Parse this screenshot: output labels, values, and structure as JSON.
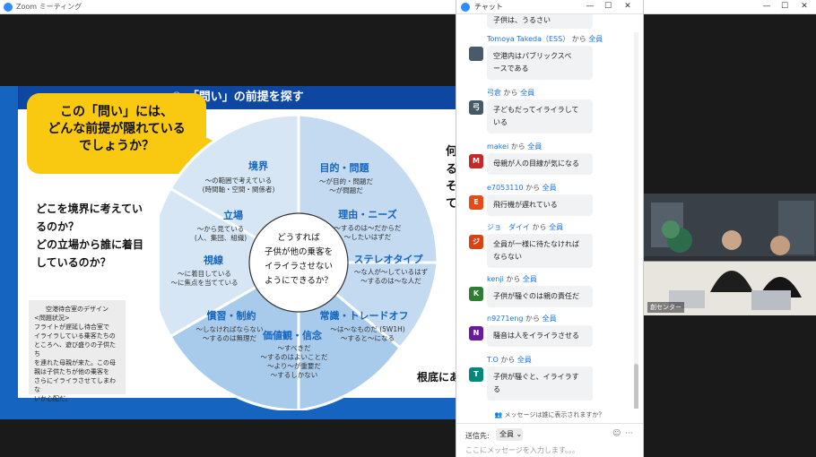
{
  "window": {
    "title": "Zoom ミーティング",
    "minimize": "—",
    "maximize": "☐",
    "close": "✕"
  },
  "slide": {
    "header": "①　「問い」の前提を探す",
    "bubble": [
      "この「問い」には、",
      "どんな前提が隠れている",
      "でしょうか？"
    ],
    "left_question": [
      "どこを境界に考えてい",
      "るのか？",
      "どの立場から誰に着目",
      "しているのか？"
    ],
    "info_box": [
      "空港待合室のデザイン",
      "<問題状況>",
      "フライトが遅延し待合室で",
      "イライラしている乗客たちの",
      "ところへ、遊び盛りの子供たち",
      "を連れた母親が来た。この母",
      "親は子供たちが他の乗客を",
      "さらにイライラさせてしまわな",
      "いか心配だ。"
    ],
    "right_frag": [
      "何",
      "る",
      "そ",
      "て"
    ],
    "root_text": "根底にあ",
    "wheel": {
      "center": [
        "どうすれば",
        "子供が他の乗客を",
        "イライラさせない",
        "ようにできるか？"
      ],
      "segments": [
        {
          "title": "境界",
          "lines": [
            "〜の範囲で考えている",
            "(時間軸・空間・関係者)"
          ]
        },
        {
          "title": "立場",
          "lines": [
            "〜から見ている",
            "(人、集団、組織)"
          ]
        },
        {
          "title": "視線",
          "lines": [
            "〜に着目している",
            "〜に焦点を当てている"
          ]
        },
        {
          "title": "目的・問題",
          "lines": [
            "〜が目的・問題だ",
            "〜が問題だ"
          ]
        },
        {
          "title": "理由・ニーズ",
          "lines": [
            "〜するのは〜だからだ",
            "〜したいはずだ"
          ]
        },
        {
          "title": "ステレオタイプ",
          "lines": [
            "〜な人が〜しているはず",
            "〜するのは〜な人だ"
          ]
        },
        {
          "title": "常識・トレードオフ",
          "lines": [
            "〜は〜なものだ (5W1H)",
            "〜すると〜になる"
          ]
        },
        {
          "title": "価値観・信念",
          "lines": [
            "〜すべきだ",
            "〜するのはよいことだ",
            "〜より〜が重要だ",
            "〜するしかない"
          ]
        },
        {
          "title": "慣習・制約",
          "lines": [
            "〜しなければならない",
            "〜するのは無理だ"
          ]
        }
      ]
    }
  },
  "chat": {
    "title": "チャット",
    "from_word": "から",
    "messages": [
      {
        "sender": "Tomoya Takeda（ESS）",
        "to": "全員",
        "avatar": "",
        "avatar_color": "#4a5a6a",
        "lines": [
          "空港内はパブリックスペ",
          "ースである"
        ]
      },
      {
        "sender": "弓倉",
        "to": "全員",
        "avatar": "弓",
        "avatar_color": "#455a64",
        "lines": [
          "子どもだってイライラして",
          "いる"
        ]
      },
      {
        "sender": "makei",
        "to": "全員",
        "avatar": "M",
        "avatar_color": "#c62828",
        "lines": [
          "母親が人の目線が気になる"
        ]
      },
      {
        "sender": "e7053110",
        "to": "全員",
        "avatar": "E",
        "avatar_color": "#e64a19",
        "lines": [
          "飛行機が遅れている"
        ]
      },
      {
        "sender": "ジョ　ダイイ",
        "to": "全員",
        "avatar": "ジ",
        "avatar_color": "#d84315",
        "lines": [
          "全員が一様に待たなければ",
          "ならない"
        ]
      },
      {
        "sender": "kenji",
        "to": "全員",
        "avatar": "K",
        "avatar_color": "#2e7d32",
        "lines": [
          "子供が騒ぐのは親の責任だ"
        ]
      },
      {
        "sender": "n9271eng",
        "to": "全員",
        "avatar": "N",
        "avatar_color": "#6a1b9a",
        "lines": [
          "騒音は人をイライラさせる"
        ]
      },
      {
        "sender": "T.O",
        "to": "全員",
        "avatar": "T",
        "avatar_color": "#00897b",
        "lines": [
          "子供が騒ぐと、イライラす",
          "る"
        ]
      }
    ],
    "top_partial": "子供は、うるさい",
    "visibility_note": "メッセージは誰に表示されますか？",
    "to_label": "送信先:",
    "to_value": "全員",
    "input_placeholder": "ここにメッセージを入力します。。。"
  },
  "video": {
    "name": "創センター"
  }
}
